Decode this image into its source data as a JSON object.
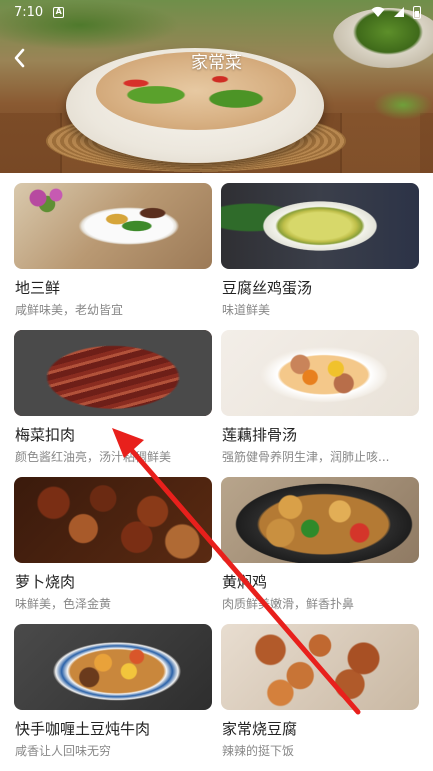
{
  "status_bar": {
    "time": "7:10",
    "notification_letter": "A"
  },
  "header": {
    "title": "家常菜",
    "back_icon": "chevron-left-icon"
  },
  "recipes": [
    {
      "title": "地三鲜",
      "subtitle": "咸鲜味美，老幼皆宜"
    },
    {
      "title": "豆腐丝鸡蛋汤",
      "subtitle": "味道鲜美"
    },
    {
      "title": "梅菜扣肉",
      "subtitle": "颜色酱红油亮，汤汁粘稠鲜美"
    },
    {
      "title": "莲藕排骨汤",
      "subtitle": "强筋健骨养阴生津，润肺止咳..."
    },
    {
      "title": "萝卜烧肉",
      "subtitle": "味鲜美，色泽金黄"
    },
    {
      "title": "黄焖鸡",
      "subtitle": "肉质鲜美嫩滑，鲜香扑鼻"
    },
    {
      "title": "快手咖喱土豆炖牛肉",
      "subtitle": "咸香让人回味无穷"
    },
    {
      "title": "家常烧豆腐",
      "subtitle": "辣辣的挺下饭"
    }
  ],
  "colors": {
    "annotation_arrow": "#e8201c",
    "title_text": "#222222",
    "subtitle_text": "#888888"
  }
}
